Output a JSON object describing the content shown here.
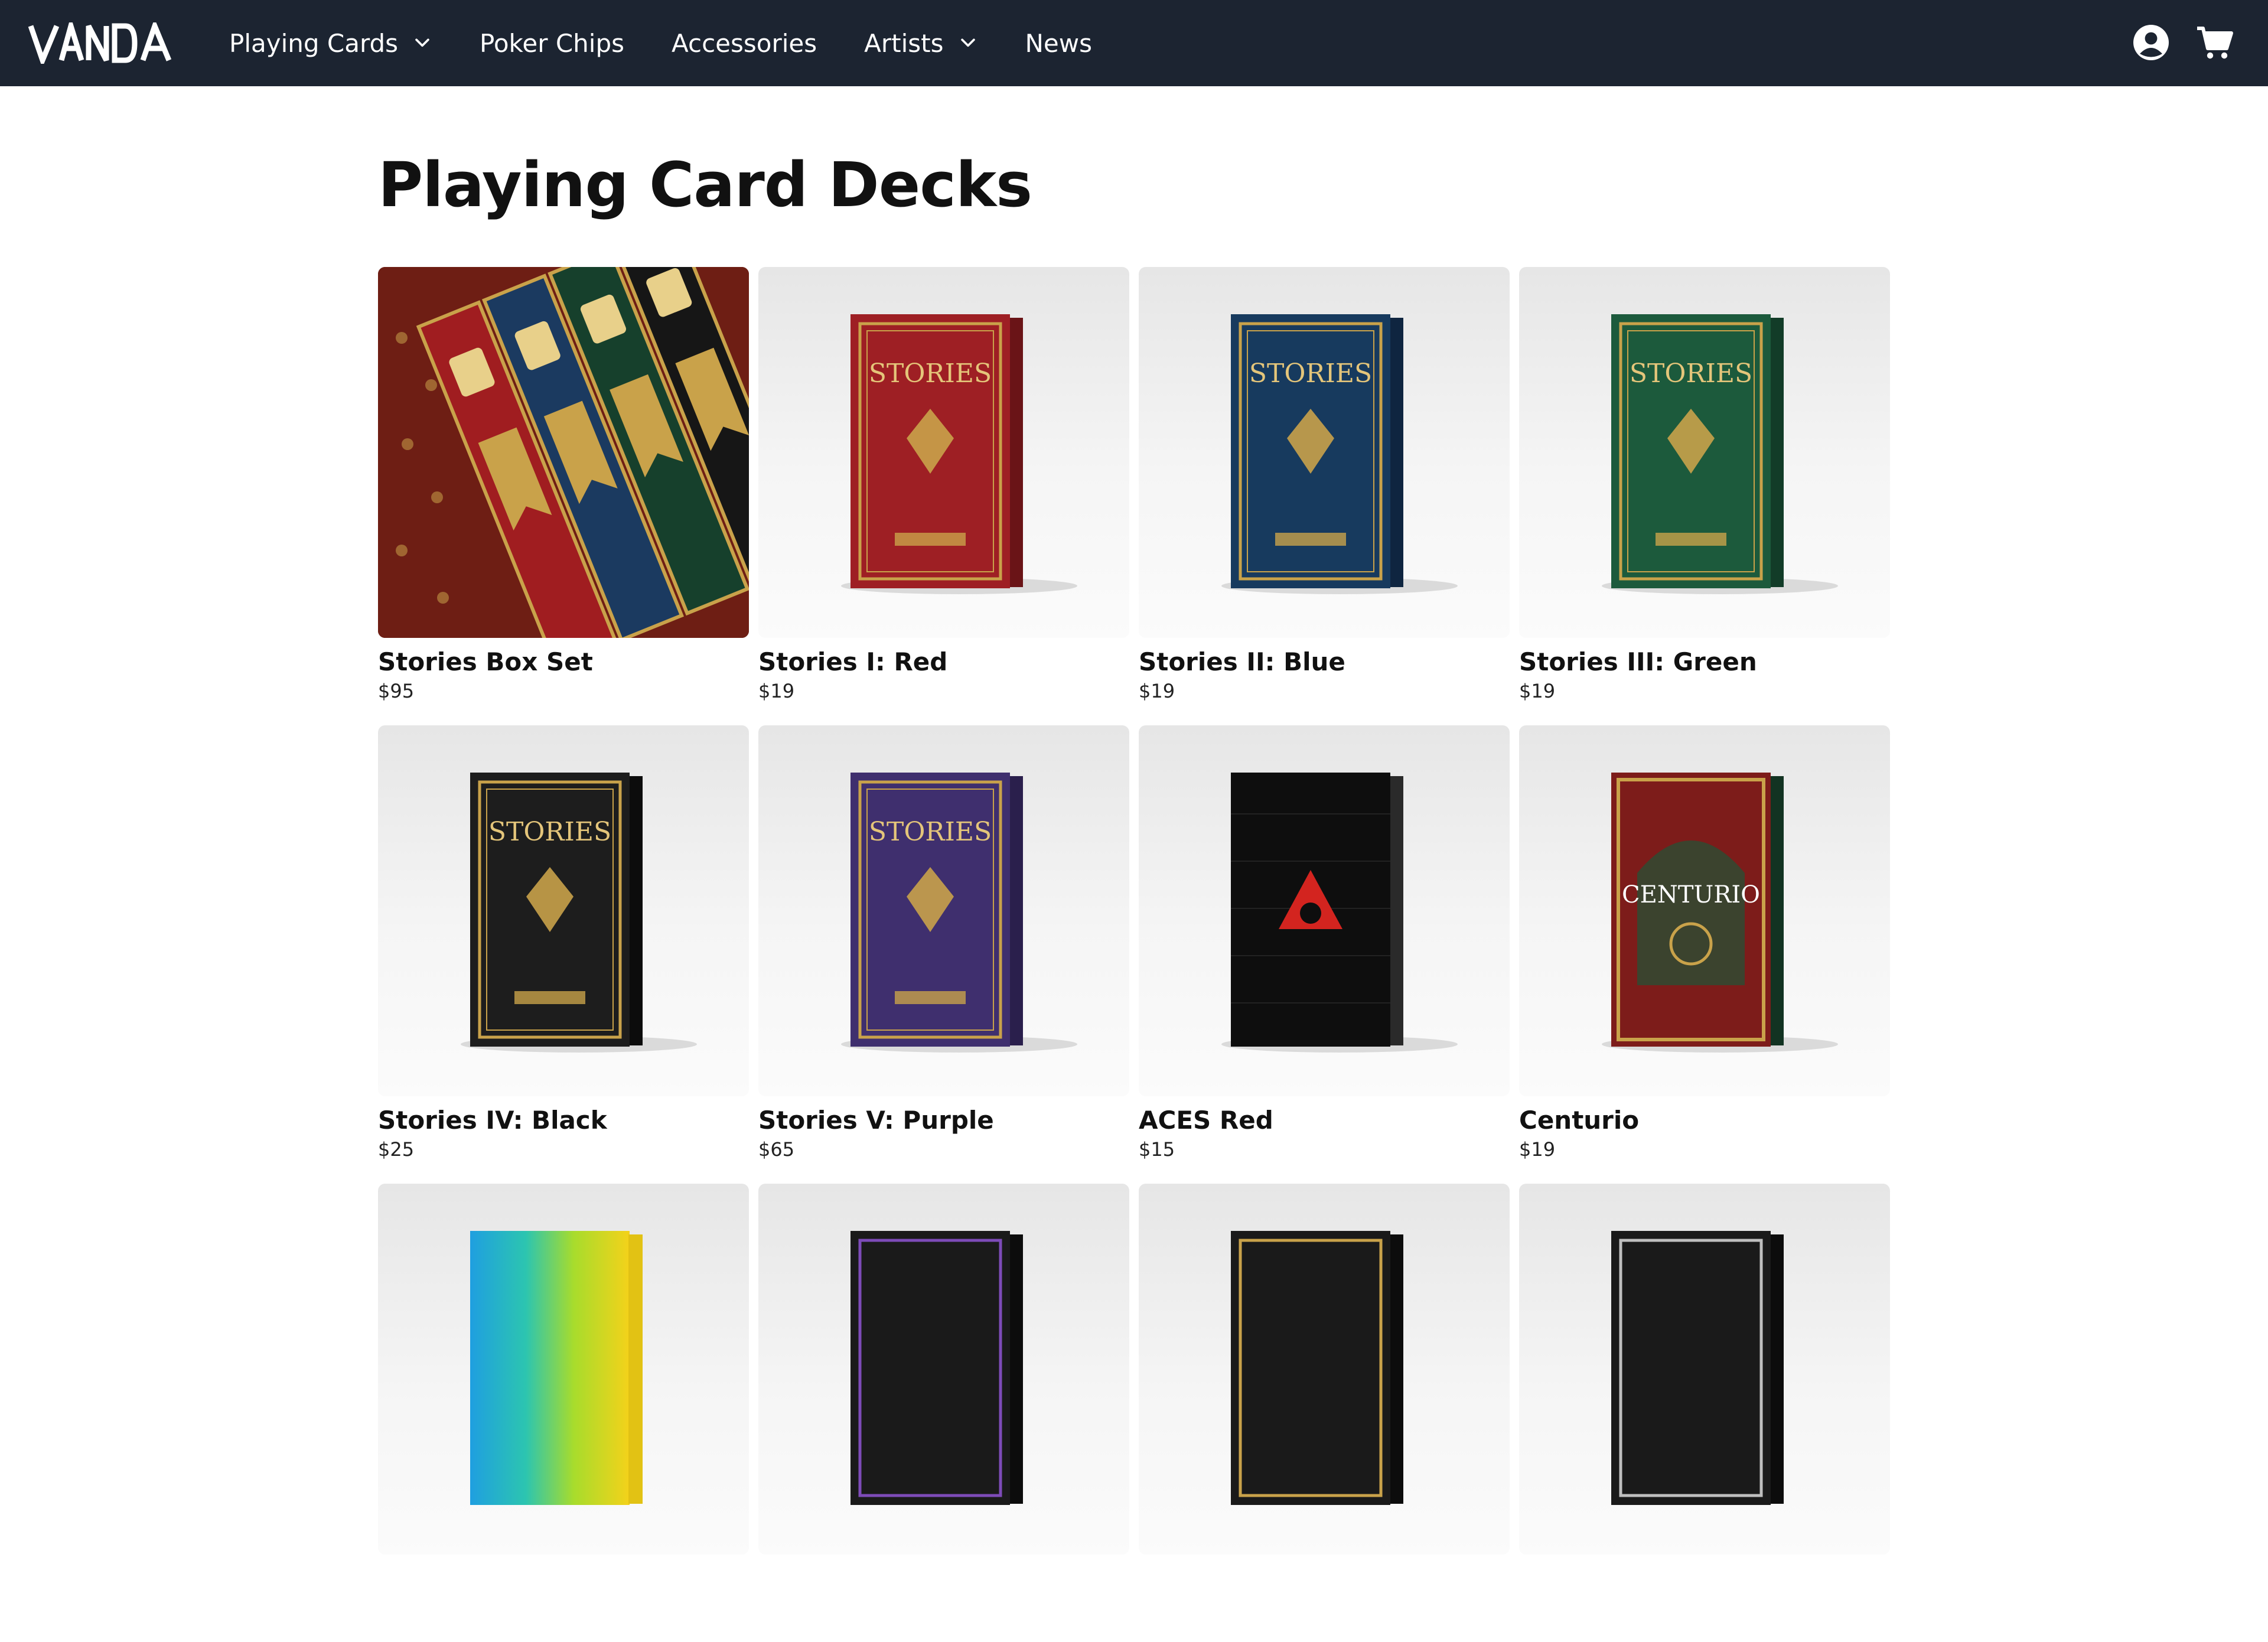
{
  "brand": {
    "name": "VANDA"
  },
  "nav": {
    "items": [
      {
        "label": "Playing Cards",
        "has_dropdown": true,
        "icon": "chevron-down-icon"
      },
      {
        "label": "Poker Chips",
        "has_dropdown": false
      },
      {
        "label": "Accessories",
        "has_dropdown": false
      },
      {
        "label": "Artists",
        "has_dropdown": true,
        "icon": "chevron-down-icon"
      },
      {
        "label": "News",
        "has_dropdown": false
      }
    ],
    "icons": [
      "account-icon",
      "cart-icon"
    ]
  },
  "page": {
    "title": "Playing Card Decks"
  },
  "products": [
    {
      "name": "Stories Box Set",
      "price": "$95",
      "image": "box-set",
      "color": "#7a1a14"
    },
    {
      "name": "Stories I: Red",
      "price": "$19",
      "image": "deck",
      "color": "#9e1f24"
    },
    {
      "name": "Stories II: Blue",
      "price": "$19",
      "image": "deck",
      "color": "#173a5e"
    },
    {
      "name": "Stories III: Green",
      "price": "$19",
      "image": "deck",
      "color": "#1c5a3c"
    },
    {
      "name": "Stories IV: Black",
      "price": "$25",
      "image": "deck",
      "color": "#1d1d1d"
    },
    {
      "name": "Stories V: Purple",
      "price": "$65",
      "image": "deck",
      "color": "#3f2f6e"
    },
    {
      "name": "ACES Red",
      "price": "$15",
      "image": "aces-deck",
      "color": "#0e0e0e"
    },
    {
      "name": "Centurio",
      "price": "$19",
      "image": "centurio-deck",
      "color": "#7d1c1a"
    },
    {
      "name": "",
      "price": "",
      "image": "rainbow-deck",
      "color": "#2ab6e8"
    },
    {
      "name": "",
      "price": "",
      "image": "dark-deck",
      "color": "#1a1a1a"
    },
    {
      "name": "",
      "price": "",
      "image": "dark-deck",
      "color": "#1a1a1a"
    },
    {
      "name": "",
      "price": "",
      "image": "dark-deck",
      "color": "#1a1a1a"
    }
  ],
  "colors": {
    "nav_bg": "#1c2431",
    "gold": "#c9a24a"
  }
}
